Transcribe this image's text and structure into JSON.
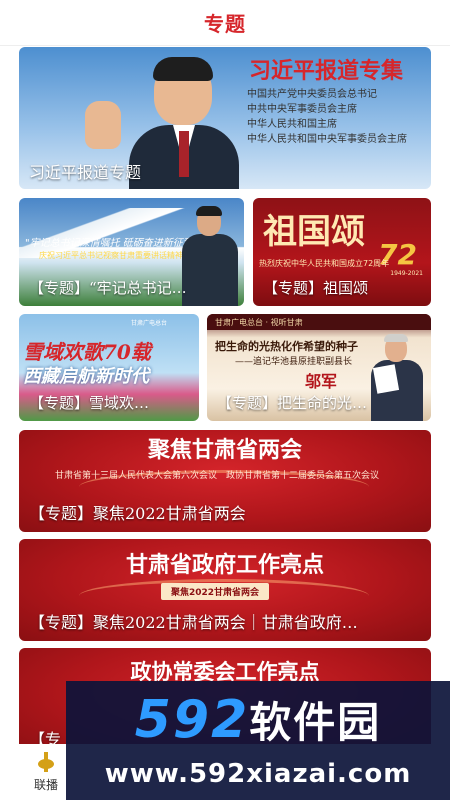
{
  "header": {
    "title": "专题"
  },
  "card1": {
    "banner_title": "习近平报道专集",
    "titles": [
      "中国共产党中央委员会总书记",
      "中共中央军事委员会主席",
      "中华人民共和国主席",
      "中华人民共和国中央军事委员会主席"
    ],
    "caption": "习近平报道专题"
  },
  "card2": {
    "overlay_script": "\"牢记总书记深情嘱托 砥砺奋进新征程\"",
    "overlay_sub": "庆祝习近平总书记视察甘肃重要讲话精神",
    "caption": "【专题】“牢记总书记…"
  },
  "card3": {
    "banner_title": "祖国颂",
    "number": "72",
    "line": "热烈庆祝中华人民共和国成立72周年",
    "years": "1949-2021",
    "caption": "【专题】祖国颂"
  },
  "card4": {
    "logo": "甘肃广电总台",
    "title_line1": "雪域欢歌70载",
    "title_line2": "西藏启航新时代",
    "caption": "【专题】雪域欢…"
  },
  "card5": {
    "logo": "甘肃广电总台 · 视听甘肃",
    "quote": "把生命的光热化作希望的种子",
    "subline": "——追记华池县原挂职副县长",
    "name": "邬军",
    "caption": "【专题】把生命的光…"
  },
  "card6": {
    "banner_title": "聚焦甘肃省两会",
    "sub": "甘肃省第十三届人民代表大会第六次会议　政协甘肃省第十二届委员会第五次会议",
    "caption": "【专题】聚焦2022甘肃省两会"
  },
  "card7": {
    "banner_title": "甘肃省政府工作亮点",
    "tag": "聚焦2022甘肃省两会",
    "caption": "【专题】聚焦2022甘肃省两会｜甘肃省政府…"
  },
  "card8": {
    "banner_title": "政协常委会工作亮点",
    "caption": "【专"
  },
  "bottom_nav": {
    "item_label": "联播"
  },
  "watermark": {
    "number": "592",
    "text": "软件园",
    "url": "www.592xiazai.com"
  },
  "colors": {
    "accent": "#d6262b",
    "banner_red": "#b0161b",
    "watermark_blue": "#2e9bff"
  }
}
